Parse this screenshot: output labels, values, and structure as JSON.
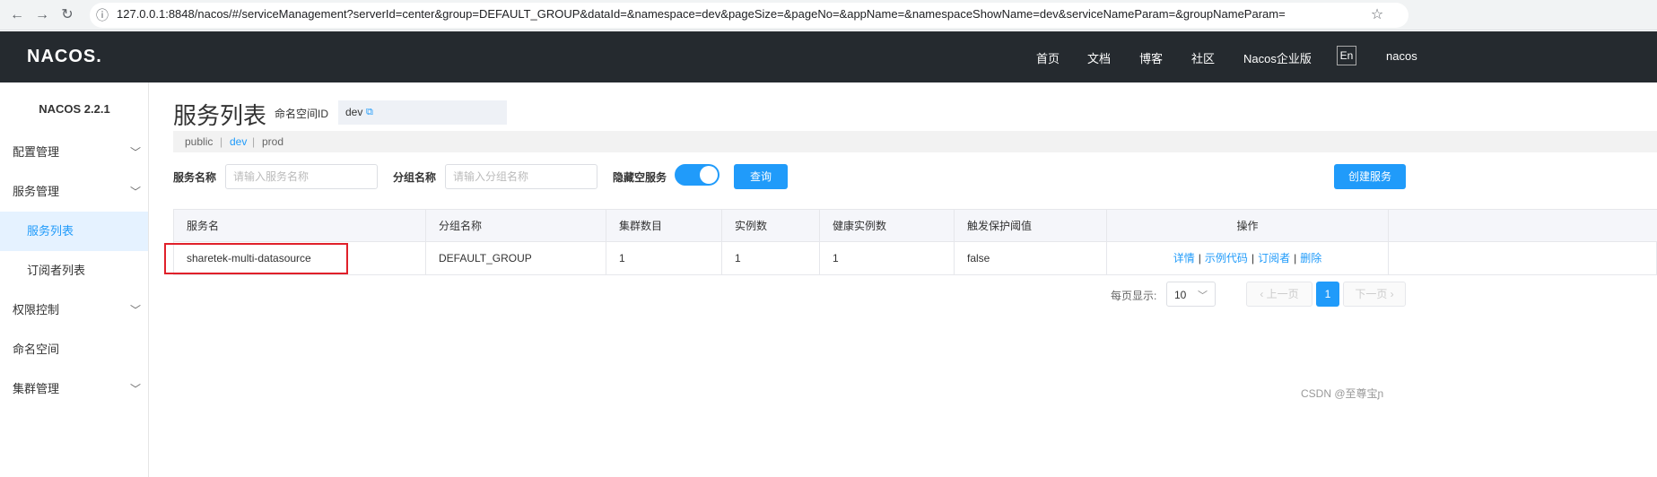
{
  "browser": {
    "url": "127.0.0.1:8848/nacos/#/serviceManagement?serverId=center&group=DEFAULT_GROUP&dataId=&namespace=dev&pageSize=&pageNo=&appName=&namespaceShowName=dev&serviceNameParam=&groupNameParam=",
    "back_icon": "←",
    "forward_icon": "→",
    "reload_icon": "↻",
    "info_icon": "ⓘ",
    "star_icon": "☆"
  },
  "header": {
    "logo": "NACOS.",
    "links": [
      "首页",
      "文档",
      "博客",
      "社区",
      "Nacos企业版"
    ],
    "lang": "En",
    "user": "nacos"
  },
  "sidebar": {
    "version": "NACOS 2.2.1",
    "items": [
      {
        "label": "配置管理",
        "expandable": true
      },
      {
        "label": "服务管理",
        "expandable": true
      },
      {
        "label": "服务列表",
        "sub": true,
        "active": true
      },
      {
        "label": "订阅者列表",
        "sub": true
      },
      {
        "label": "权限控制",
        "expandable": true
      },
      {
        "label": "命名空间",
        "expandable": false
      },
      {
        "label": "集群管理",
        "expandable": true
      }
    ]
  },
  "main": {
    "title": "服务列表",
    "namespace_label": "命名空间ID",
    "namespace_value": "dev",
    "namespace_tabs": [
      "public",
      "dev",
      "prod"
    ],
    "namespace_separator": "|",
    "active_namespace": "dev",
    "filters": {
      "service_name_label": "服务名称",
      "service_name_placeholder": "请输入服务名称",
      "group_name_label": "分组名称",
      "group_name_placeholder": "请输入分组名称",
      "hide_empty_label": "隐藏空服务",
      "hide_empty_on": true,
      "query_button": "查询",
      "create_button": "创建服务"
    },
    "table": {
      "columns": [
        "服务名",
        "分组名称",
        "集群数目",
        "实例数",
        "健康实例数",
        "触发保护阈值",
        "操作"
      ],
      "rows": [
        {
          "service": "sharetek-multi-datasource",
          "group": "DEFAULT_GROUP",
          "clusters": "1",
          "instances": "1",
          "healthy": "1",
          "protect": "false",
          "ops": [
            "详情",
            "示例代码",
            "订阅者",
            "删除"
          ]
        }
      ]
    },
    "pagination": {
      "per_page_label": "每页显示:",
      "page_size": "10",
      "prev": "上一页",
      "next": "下一页",
      "current": "1"
    }
  },
  "watermark": "CSDN @至尊宝ɲ",
  "colors": {
    "accent": "#209bfa",
    "header_bg": "#252a2f",
    "highlight": "#e0202a"
  }
}
